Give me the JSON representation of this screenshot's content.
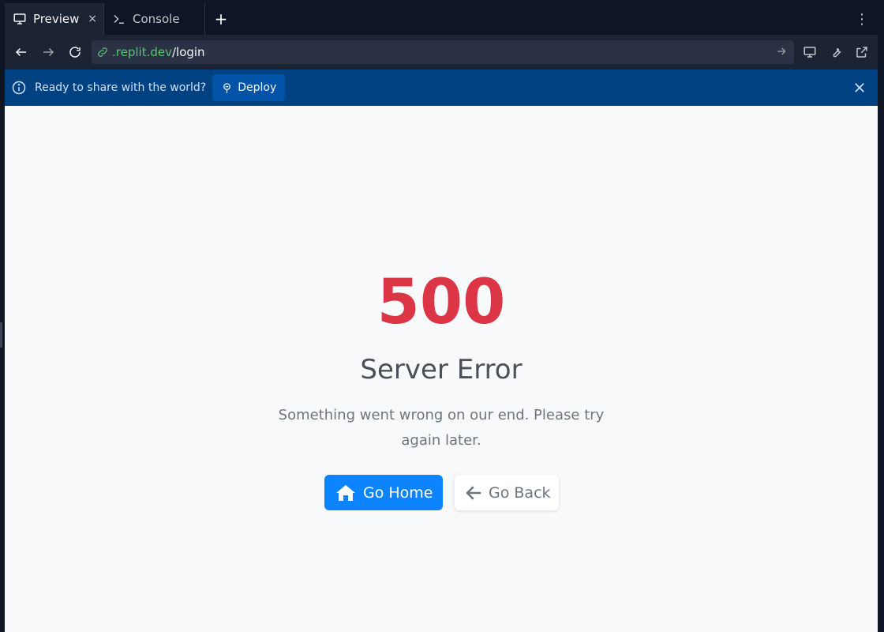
{
  "tabs": [
    {
      "label": "Preview",
      "icon": "monitor-icon",
      "active": true
    },
    {
      "label": "Console",
      "icon": "terminal-icon",
      "active": false
    }
  ],
  "tab_add": "+",
  "tab_close": "×",
  "tab_menu": "⋮",
  "url": {
    "host": ".replit.dev",
    "path": "/login"
  },
  "banner": {
    "text": "Ready to share with the world?",
    "deploy_label": "Deploy"
  },
  "error": {
    "code": "500",
    "title": "Server Error",
    "message": "Something went wrong on our end. Please try again later."
  },
  "buttons": {
    "home": "Go Home",
    "back": "Go Back"
  },
  "colors": {
    "error_red": "#dc3545",
    "primary_blue": "#0d84ff",
    "banner_blue": "#004182",
    "url_host_green": "#58c472"
  }
}
